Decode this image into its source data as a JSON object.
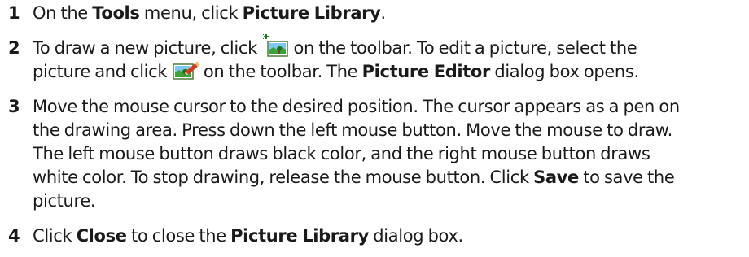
{
  "steps": [
    {
      "number": "1",
      "lines": [
        {
          "t1": "On the ",
          "b1": "Tools",
          "t2": " menu, click ",
          "b2": "Picture Library",
          "t3": "."
        }
      ]
    },
    {
      "number": "2",
      "lines": [
        {
          "t1": "To draw a new picture, click ",
          "icon": "new-picture-icon",
          "t2": " on the toolbar. To edit a picture, select the"
        },
        {
          "t1": "picture and click ",
          "icon": "edit-picture-icon",
          "t2": " on the toolbar. The ",
          "b1": "Picture Editor",
          "t3": " dialog box opens."
        }
      ]
    },
    {
      "number": "3",
      "lines": [
        {
          "t1": "Move the mouse cursor to the desired position. The cursor appears as a pen on"
        },
        {
          "t1": "the drawing area. Press down the left mouse button. Move the mouse to draw."
        },
        {
          "t1": "The left mouse button draws black color, and the right mouse button draws"
        },
        {
          "t1": "white color. To stop drawing, release the mouse button. Click ",
          "b1": "Save",
          "t2": " to save the"
        },
        {
          "t1": "picture."
        }
      ]
    },
    {
      "number": "4",
      "lines": [
        {
          "t1": "Click ",
          "b1": "Close",
          "t2": " to close the ",
          "b2": "Picture Library",
          "t3": " dialog box."
        }
      ]
    }
  ],
  "colors": {
    "text": "#1a1a1a",
    "icon_green": "#2e9e2e",
    "icon_frame": "#3a6a2a"
  }
}
